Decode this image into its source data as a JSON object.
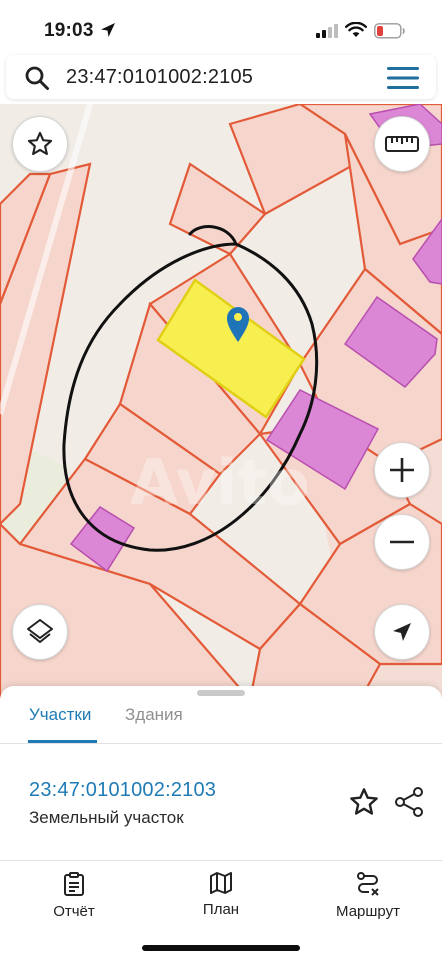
{
  "status_bar": {
    "time": "19:03"
  },
  "search": {
    "query": "23:47:0101002:2105"
  },
  "map": {
    "watermark": "Avito",
    "colors": {
      "parcel_fill": "#f6d6cc",
      "parcel_border": "#e35a38",
      "selected_fill": "#f7ee4f",
      "selected_border": "#e1cf14",
      "building_fill": "#dc86d6",
      "building_border": "#b84fae",
      "marker": "#1f74b8"
    }
  },
  "sheet": {
    "tabs": [
      {
        "label": "Участки",
        "active": true
      },
      {
        "label": "Здания",
        "active": false
      }
    ],
    "parcel": {
      "number": "23:47:0101002:2103",
      "type": "Земельный участок"
    }
  },
  "bottom_nav": [
    {
      "label": "Отчёт",
      "icon": "clipboard-icon"
    },
    {
      "label": "План",
      "icon": "map-icon"
    },
    {
      "label": "Маршрут",
      "icon": "route-icon"
    }
  ],
  "theme": {
    "accent": "#1f7bb6"
  }
}
